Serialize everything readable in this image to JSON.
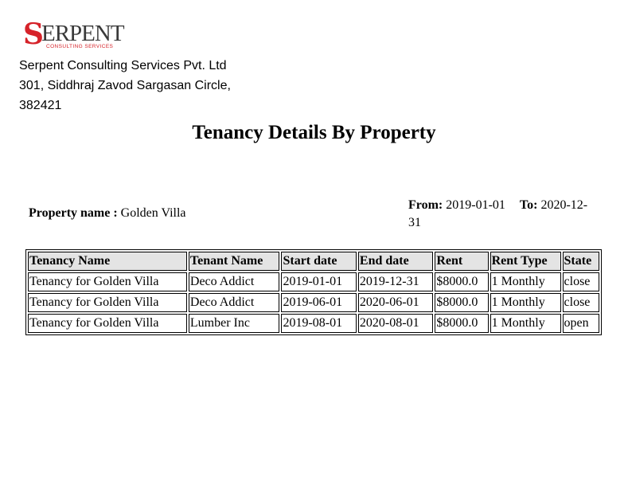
{
  "logo": {
    "text": "SERPENT",
    "tagline": "CONSULTING SERVICES",
    "colors": {
      "s_red": "#d6232a",
      "text_dark": "#3a3a3a",
      "tagline_red": "#d6232a"
    }
  },
  "company": {
    "name": "Serpent Consulting Services Pvt. Ltd",
    "address_line1": "301, Siddhraj Zavod Sargasan Circle,",
    "address_line2": "382421"
  },
  "report": {
    "title": "Tenancy Details By Property",
    "property_label": "Property name :",
    "property_value": "Golden Villa",
    "from_label": "From:",
    "from_value": "2019-01-01",
    "to_label": "To:",
    "to_value": "2020-12-31"
  },
  "table": {
    "headers": [
      "Tenancy Name",
      "Tenant Name",
      "Start date",
      "End date",
      "Rent",
      "Rent Type",
      "State"
    ],
    "rows": [
      [
        "Tenancy for Golden Villa",
        "Deco Addict",
        "2019-01-01",
        "2019-12-31",
        "$8000.0",
        "1 Monthly",
        "close"
      ],
      [
        "Tenancy for Golden Villa",
        "Deco Addict",
        "2019-06-01",
        "2020-06-01",
        "$8000.0",
        "1 Monthly",
        "close"
      ],
      [
        "Tenancy for Golden Villa",
        "Lumber Inc",
        "2019-08-01",
        "2020-08-01",
        "$8000.0",
        "1 Monthly",
        "open"
      ]
    ]
  }
}
